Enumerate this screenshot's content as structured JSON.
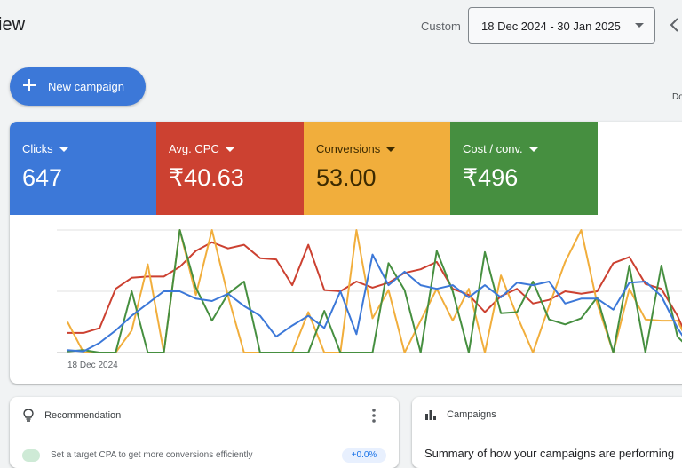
{
  "header": {
    "title": "iew",
    "range_label": "Custom",
    "date_range": "18 Dec 2024 - 30 Jan 2025",
    "prev_icon": "chevron-left-icon"
  },
  "toolbar": {
    "new_campaign_label": "New campaign",
    "new_campaign_icon": "plus-icon",
    "cut_label": "Do"
  },
  "metrics": [
    {
      "label": "Clicks",
      "value": "647",
      "color": "#3c78d8"
    },
    {
      "label": "Avg. CPC",
      "value": "₹40.63",
      "color": "#cc4131"
    },
    {
      "label": "Conversions",
      "value": "53.00",
      "color": "#f1ae3c"
    },
    {
      "label": "Cost / conv.",
      "value": "₹496",
      "color": "#468f40"
    }
  ],
  "chart_data": {
    "type": "line",
    "x_start_label": "18 Dec 2024",
    "grid": true,
    "y_scale": "normalized 0-1 per series (no axis values shown)",
    "series": [
      {
        "name": "Clicks",
        "color": "#3c78d8",
        "values": [
          0.02,
          0.01,
          0.08,
          0.18,
          0.3,
          0.4,
          0.5,
          0.5,
          0.44,
          0.42,
          0.48,
          0.38,
          0.3,
          0.13,
          0.22,
          0.3,
          0.2,
          0.5,
          0.15,
          0.8,
          0.55,
          0.66,
          0.55,
          0.52,
          0.55,
          0.45,
          0.55,
          0.45,
          0.57,
          0.55,
          0.58,
          0.4,
          0.44,
          0.44,
          0.35,
          0.57,
          0.58,
          0.46,
          0.2,
          0.0
        ]
      },
      {
        "name": "Avg. CPC",
        "color": "#cc4131",
        "values": [
          0.16,
          0.16,
          0.2,
          0.52,
          0.61,
          0.62,
          0.62,
          0.7,
          0.83,
          0.9,
          0.85,
          0.88,
          0.77,
          0.76,
          0.55,
          0.88,
          0.51,
          0.5,
          0.58,
          0.53,
          0.57,
          0.65,
          0.68,
          0.74,
          0.52,
          0.47,
          0.33,
          0.46,
          0.52,
          0.4,
          0.43,
          0.5,
          0.48,
          0.5,
          0.73,
          0.78,
          0.56,
          0.52,
          0.3,
          0.0
        ]
      },
      {
        "name": "Conversions",
        "color": "#f1ae3c",
        "values": [
          0.25,
          0.0,
          0.0,
          0.0,
          0.18,
          0.72,
          0.0,
          1.0,
          0.47,
          1.0,
          0.46,
          0.0,
          0.0,
          0.0,
          0.0,
          0.33,
          0.0,
          0.0,
          1.0,
          0.28,
          0.51,
          0.0,
          0.26,
          0.52,
          0.26,
          0.52,
          0.0,
          0.63,
          0.3,
          0.0,
          0.38,
          0.74,
          1.0,
          0.4,
          0.0,
          0.52,
          0.27,
          0.26,
          0.26,
          0.0
        ]
      },
      {
        "name": "Cost / conv.",
        "color": "#468f40",
        "values": [
          0.01,
          0.02,
          0.0,
          0.0,
          0.5,
          0.0,
          0.0,
          1.0,
          0.53,
          0.26,
          0.48,
          0.58,
          0.0,
          0.0,
          0.0,
          0.0,
          0.34,
          0.0,
          0.0,
          0.0,
          0.73,
          0.51,
          0.0,
          0.83,
          0.5,
          0.0,
          0.82,
          0.32,
          0.33,
          0.58,
          0.27,
          0.23,
          0.28,
          0.45,
          0.0,
          0.71,
          0.0,
          0.71,
          0.13,
          0.0
        ]
      }
    ]
  },
  "recommendation_card": {
    "title": "Recommendation",
    "icon": "lightbulb-icon",
    "menu_icon": "more-vert-icon",
    "item_text": "Set a target CPA to get more conversions efficiently",
    "item_badge": "+0.0%"
  },
  "campaigns_card": {
    "title": "Campaigns",
    "icon": "bar-chart-icon",
    "summary": "Summary of how your campaigns are performing"
  }
}
